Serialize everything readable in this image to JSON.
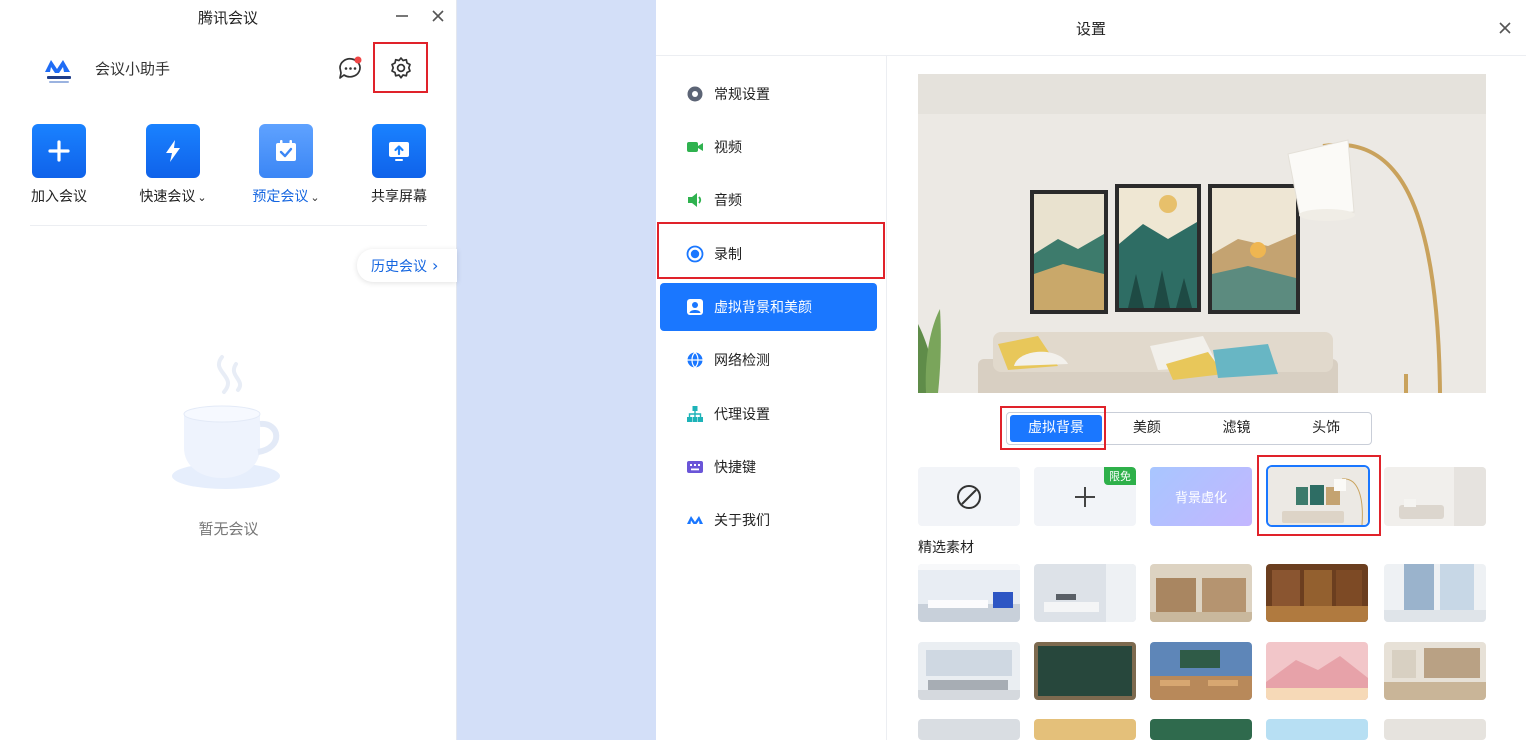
{
  "colors": {
    "accent": "#1a77ff",
    "highlight_frame": "#e0222a",
    "desktop_bg": "#d3dff8",
    "badge_green": "#2eb04a"
  },
  "main_window": {
    "title": "腾讯会议",
    "logo_icon": "tencent-meeting-logo",
    "assistant_label": "会议小助手",
    "actions": [
      {
        "label": "加入会议",
        "icon": "plus-icon"
      },
      {
        "label": "快速会议",
        "icon": "lightning-icon",
        "dropdown": true
      },
      {
        "label": "预定会议",
        "icon": "calendar-check-icon",
        "dropdown": true
      },
      {
        "label": "共享屏幕",
        "icon": "share-screen-icon"
      }
    ],
    "history_button": "历史会议",
    "empty_text": "暂无会议"
  },
  "settings": {
    "title": "设置",
    "nav": [
      {
        "label": "常规设置",
        "icon": "gear-icon"
      },
      {
        "label": "视频",
        "icon": "camera-icon"
      },
      {
        "label": "音频",
        "icon": "speaker-icon"
      },
      {
        "label": "录制",
        "icon": "record-icon"
      },
      {
        "label": "虚拟背景和美颜",
        "icon": "portrait-icon",
        "active": true
      },
      {
        "label": "网络检测",
        "icon": "globe-icon"
      },
      {
        "label": "代理设置",
        "icon": "network-tree-icon"
      },
      {
        "label": "快捷键",
        "icon": "keyboard-icon"
      },
      {
        "label": "关于我们",
        "icon": "tencent-meeting-logo"
      }
    ],
    "tabs": [
      "虚拟背景",
      "美颜",
      "滤镜",
      "头饰"
    ],
    "active_tab": "虚拟背景",
    "background_options": {
      "blur_label": "背景虚化",
      "limited_badge": "限免"
    },
    "featured_label": "精选素材"
  }
}
